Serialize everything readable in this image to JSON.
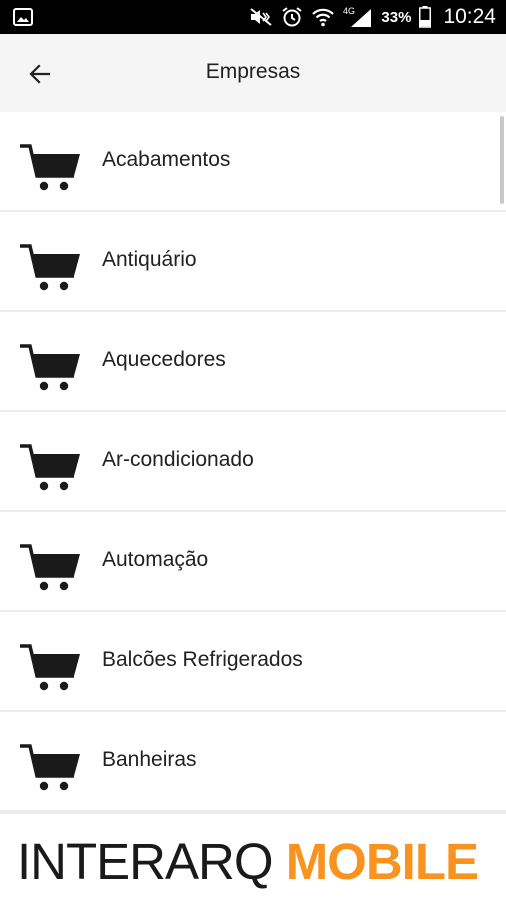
{
  "status_bar": {
    "battery_percent": "33%",
    "network": "4G",
    "time": "10:24"
  },
  "app_bar": {
    "title": "Empresas"
  },
  "list": {
    "items": [
      {
        "label": "Acabamentos"
      },
      {
        "label": "Antiquário"
      },
      {
        "label": "Aquecedores"
      },
      {
        "label": "Ar-condicionado"
      },
      {
        "label": "Automação"
      },
      {
        "label": "Balcões Refrigerados"
      },
      {
        "label": "Banheiras"
      }
    ]
  },
  "footer": {
    "brand_part1": "INTERARQ ",
    "brand_part2": "MOBILE",
    "brand_color": "#f7931e"
  }
}
